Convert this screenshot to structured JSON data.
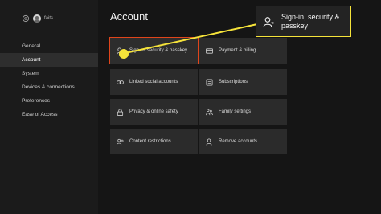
{
  "profile": {
    "gamertag": "faits"
  },
  "sidebar": {
    "items": [
      {
        "label": "General",
        "active": false
      },
      {
        "label": "Account",
        "active": true
      },
      {
        "label": "System",
        "active": false
      },
      {
        "label": "Devices & connections",
        "active": false
      },
      {
        "label": "Preferences",
        "active": false
      },
      {
        "label": "Ease of Access",
        "active": false
      }
    ]
  },
  "page": {
    "title": "Account"
  },
  "tiles": [
    {
      "label": "Sign-in, security & passkey",
      "icon": "person-key-icon",
      "focused": true
    },
    {
      "label": "Payment & billing",
      "icon": "credit-card-icon",
      "focused": false
    },
    {
      "label": "Linked social accounts",
      "icon": "link-icon",
      "focused": false
    },
    {
      "label": "Subscriptions",
      "icon": "subscriptions-icon",
      "focused": false
    },
    {
      "label": "Privacy & online safety",
      "icon": "lock-icon",
      "focused": false
    },
    {
      "label": "Family settings",
      "icon": "family-icon",
      "focused": false
    },
    {
      "label": "Content restrictions",
      "icon": "people-restrictions-icon",
      "focused": false
    },
    {
      "label": "Remove accounts",
      "icon": "person-remove-icon",
      "focused": false
    }
  ],
  "callout": {
    "text": "Sign-in, security & passkey",
    "icon": "person-key-icon"
  },
  "colors": {
    "background": "#151515",
    "sidebar": "#1b1b1b",
    "tile": "#2b2b2b",
    "focus_border": "#e0451b",
    "callout_accent": "#f5e33a"
  }
}
